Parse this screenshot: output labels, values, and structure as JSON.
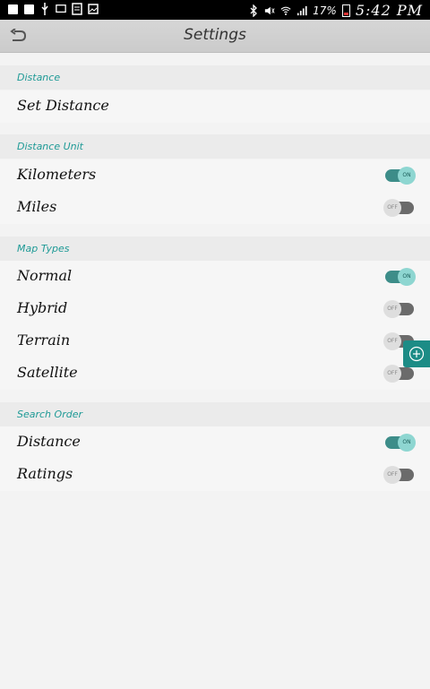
{
  "status_bar": {
    "battery": "17%",
    "time": "5:42 PM"
  },
  "app_bar": {
    "title": "Settings"
  },
  "sections": {
    "distance": {
      "header": "Distance",
      "set_distance": "Set Distance"
    },
    "distance_unit": {
      "header": "Distance Unit",
      "kilometers": {
        "label": "Kilometers",
        "state": "ON"
      },
      "miles": {
        "label": "Miles",
        "state": "OFF"
      }
    },
    "map_types": {
      "header": "Map Types",
      "normal": {
        "label": "Normal",
        "state": "ON"
      },
      "hybrid": {
        "label": "Hybrid",
        "state": "OFF"
      },
      "terrain": {
        "label": "Terrain",
        "state": "OFF"
      },
      "satellite": {
        "label": "Satellite",
        "state": "OFF"
      }
    },
    "search_order": {
      "header": "Search Order",
      "distance": {
        "label": "Distance",
        "state": "ON"
      },
      "ratings": {
        "label": "Ratings",
        "state": "OFF"
      }
    }
  },
  "colors": {
    "accent": "#1e9a96",
    "toggle_on_track": "#3d8d89",
    "toggle_off_track": "#6b6b6b"
  }
}
